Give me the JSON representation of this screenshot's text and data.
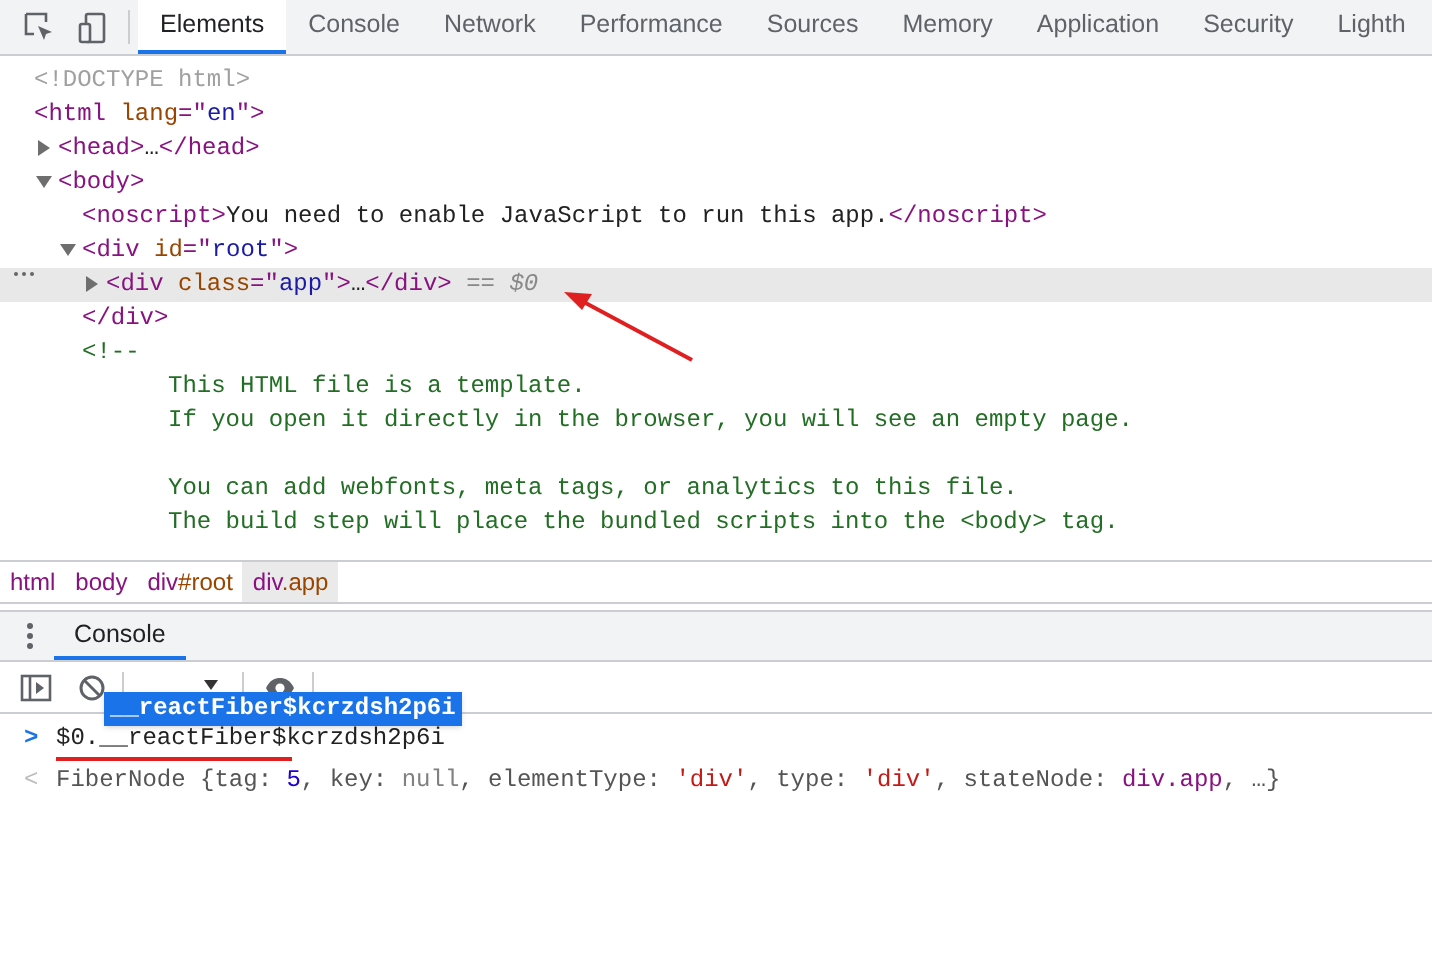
{
  "tabs": [
    {
      "label": "Elements",
      "selected": true
    },
    {
      "label": "Console",
      "selected": false
    },
    {
      "label": "Network",
      "selected": false
    },
    {
      "label": "Performance",
      "selected": false
    },
    {
      "label": "Sources",
      "selected": false
    },
    {
      "label": "Memory",
      "selected": false
    },
    {
      "label": "Application",
      "selected": false
    },
    {
      "label": "Security",
      "selected": false
    },
    {
      "label": "Lighth",
      "selected": false
    }
  ],
  "dom_tree": [
    {
      "selected": false,
      "segments": [
        {
          "kind": "doctype",
          "text": "<!DOCTYPE html>"
        }
      ]
    },
    {
      "selected": false,
      "segments": [
        {
          "kind": "tag",
          "text": "<html"
        },
        {
          "kind": "attr",
          "text": " lang"
        },
        {
          "kind": "tag",
          "text": "=\""
        },
        {
          "kind": "value",
          "text": "en"
        },
        {
          "kind": "tag",
          "text": "\">"
        }
      ],
      "children": [
        {
          "selected": false,
          "expanded": false,
          "segments": [
            {
              "kind": "tag",
              "text": "<head>"
            },
            {
              "kind": "text",
              "text": "…"
            },
            {
              "kind": "tag",
              "text": "</head>"
            }
          ]
        },
        {
          "selected": false,
          "expanded": true,
          "segments": [
            {
              "kind": "tag",
              "text": "<body>"
            }
          ],
          "children": [
            {
              "selected": false,
              "segments": [
                {
                  "kind": "tag",
                  "text": "<noscript>"
                },
                {
                  "kind": "text",
                  "text": "You need to enable JavaScript to run this app."
                },
                {
                  "kind": "tag",
                  "text": "</noscript>"
                }
              ]
            },
            {
              "selected": false,
              "expanded": true,
              "segments": [
                {
                  "kind": "tag",
                  "text": "<div"
                },
                {
                  "kind": "attr",
                  "text": " id"
                },
                {
                  "kind": "tag",
                  "text": "=\""
                },
                {
                  "kind": "value",
                  "text": "root"
                },
                {
                  "kind": "tag",
                  "text": "\">"
                }
              ],
              "children": [
                {
                  "selected": true,
                  "expanded": false,
                  "segments": [
                    {
                      "kind": "tag",
                      "text": "<div"
                    },
                    {
                      "kind": "attr",
                      "text": " class"
                    },
                    {
                      "kind": "tag",
                      "text": "=\""
                    },
                    {
                      "kind": "value",
                      "text": "app"
                    },
                    {
                      "kind": "tag",
                      "text": "\">"
                    },
                    {
                      "kind": "text",
                      "text": "…"
                    },
                    {
                      "kind": "tag",
                      "text": "</div>"
                    },
                    {
                      "kind": "dim",
                      "text": " == "
                    },
                    {
                      "kind": "ref",
                      "text": "$0"
                    }
                  ]
                }
              ],
              "closing": "</div>"
            },
            {
              "selected": false,
              "segments": [
                {
                  "kind": "comment",
                  "text": "<!--"
                }
              ],
              "comment_paragraphs": [
                [
                  "This HTML file is a template.",
                  "If you open it directly in the browser, you will see an empty page."
                ],
                [
                  "You can add webfonts, meta tags, or analytics to this file.",
                  "The build step will place the bundled scripts into the <body> tag."
                ]
              ]
            }
          ]
        }
      ]
    }
  ],
  "breadcrumbs": [
    {
      "label": "html",
      "selected": false
    },
    {
      "label": "body",
      "selected": false
    },
    {
      "label": "div",
      "suffix": "#root",
      "selected": false
    },
    {
      "label": "div",
      "suffix": ".app",
      "selected": true
    }
  ],
  "drawer_tabs": [
    {
      "label": "Console",
      "selected": true
    }
  ],
  "autocomplete": {
    "suggestion": "__reactFiber$kcrzdsh2p6i"
  },
  "console_input": {
    "prompt": ">",
    "value": "$0.__reactFiber$kcrzdsh2p6i"
  },
  "console_output": {
    "prompt": "<",
    "segments": [
      {
        "kind": "plain",
        "text": "FiberNode {tag: "
      },
      {
        "kind": "number",
        "text": "5"
      },
      {
        "kind": "plain",
        "text": ", key: "
      },
      {
        "kind": "null",
        "text": "null"
      },
      {
        "kind": "plain",
        "text": ", elementType: "
      },
      {
        "kind": "string",
        "text": "'div'"
      },
      {
        "kind": "plain",
        "text": ", type: "
      },
      {
        "kind": "string",
        "text": "'div'"
      },
      {
        "kind": "plain",
        "text": ", stateNode: "
      },
      {
        "kind": "node",
        "text": "div.app"
      },
      {
        "kind": "plain",
        "text": ", …}"
      }
    ]
  }
}
